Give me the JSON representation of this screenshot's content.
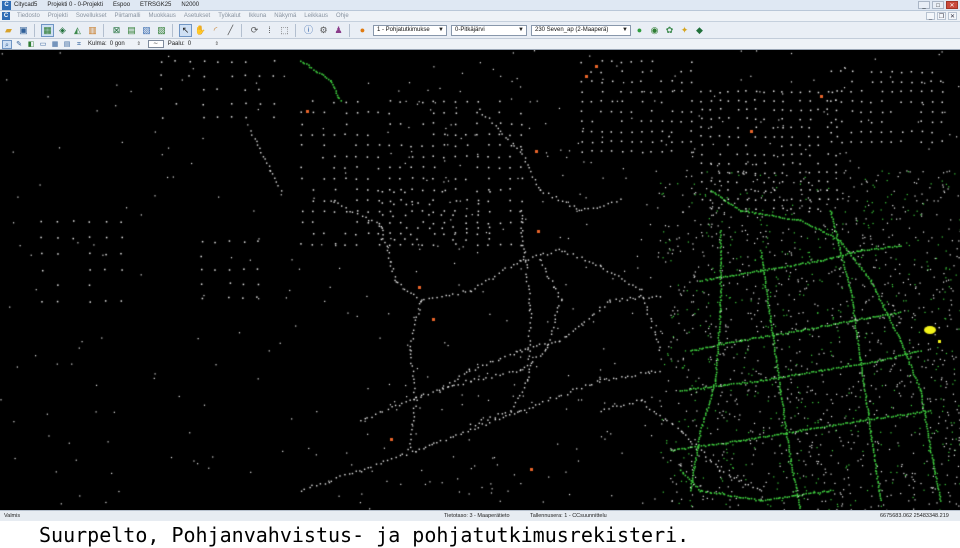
{
  "window": {
    "app_name": "Citycad5",
    "project": "Projekti 0 - 0-Projekti",
    "location": "Espoo",
    "crs": "ETRSGK25",
    "height_system": "N2000",
    "controls": {
      "minimize": "_",
      "maximize": "□",
      "close": "✕"
    }
  },
  "menubar": {
    "items": [
      "Tiedosto",
      "Projekti",
      "Sovellukset",
      "Piirtamalli",
      "Muokkaus",
      "Asetukset",
      "Työkalut",
      "Ikkuna",
      "Näkymä",
      "Leikkaus",
      "Ohje"
    ],
    "mdi_controls": {
      "minimize": "_",
      "restore": "❐",
      "close": "✕"
    }
  },
  "toolbar": {
    "layer_select": "1 - Pohjatutkimukse",
    "region_select": "0-Pitkäjärvi",
    "coord_select": "230 Seven_ap (2-Maaperä)"
  },
  "toolbar2": {
    "angle_label": "Kulma:",
    "angle_value": "0 gon",
    "distance_label": "Paalu:",
    "distance_value": "0"
  },
  "statusbar": {
    "status": "Valmis",
    "level": "Tietotaso: 3 - Maaperätieto",
    "save_target": "Tallennusera: 1 - CCsuunnittelu",
    "coordinates": "6675683.062   25483348.219"
  },
  "caption": "Suurpelto, Pohjanvahvistus- ja pohjatutkimusrekisteri.",
  "colors": {
    "map_background": "#000000",
    "borehole_white": "#e8e8e8",
    "utility_green": "#3fcf3f",
    "marker_orange": "#e8642a",
    "highlight_yellow": "#f2f21a"
  },
  "icons": {
    "tb1": "open-folder-icon",
    "tb2": "save-icon",
    "tb3": "grid-map-icon",
    "tb4": "layers-icon",
    "tb5": "terrain-icon",
    "tb6": "chart-icon",
    "tb7": "zoom-extent-icon",
    "tb8": "map-view-icon",
    "tb9": "image-icon",
    "tb10": "raster-icon",
    "tb11": "select-arrow-icon",
    "tb12": "dot-grid-icon",
    "tb13": "box-select-icon",
    "tb14": "pan-hand-icon",
    "tb15": "rotate-icon",
    "tb16": "arc-icon",
    "tb17": "line-icon",
    "tb18": "info-icon",
    "tb19": "properties-icon",
    "tb20": "user-icon",
    "tb21": "help-icon",
    "tb22": "green-globe-icon",
    "tb23": "database-icon",
    "tb24": "network-icon",
    "tb25": "star-icon",
    "tb26": "export-icon"
  }
}
